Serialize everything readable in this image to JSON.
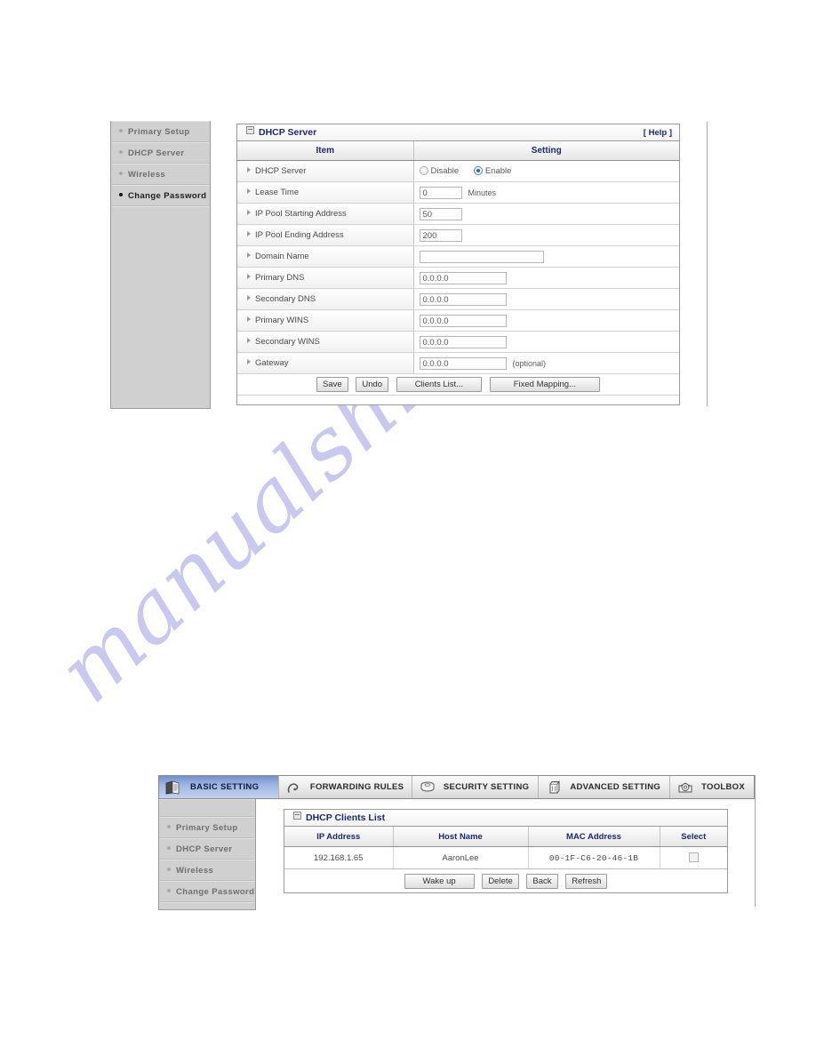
{
  "watermark": {
    "text": "manualshive.com"
  },
  "figure_top": {
    "sidebar": {
      "items": [
        {
          "label": "Primary Setup",
          "active": false
        },
        {
          "label": "DHCP Server",
          "active": false
        },
        {
          "label": "Wireless",
          "active": false
        },
        {
          "label": "Change Password",
          "active": true
        }
      ]
    },
    "panel": {
      "title": "DHCP Server",
      "help_label": "[ Help ]",
      "columns": {
        "item": "Item",
        "setting": "Setting"
      },
      "rows": [
        {
          "label": "DHCP Server",
          "type": "radio",
          "options": [
            {
              "label": "Disable",
              "selected": false
            },
            {
              "label": "Enable",
              "selected": true
            }
          ]
        },
        {
          "label": "Lease Time",
          "type": "text",
          "value": "0",
          "width": "small",
          "suffix": "Minutes"
        },
        {
          "label": "IP Pool Starting Address",
          "type": "text",
          "value": "50",
          "width": "small",
          "suffix": ""
        },
        {
          "label": "IP Pool Ending Address",
          "type": "text",
          "value": "200",
          "width": "small",
          "suffix": ""
        },
        {
          "label": "Domain Name",
          "type": "text",
          "value": "",
          "width": "wide",
          "suffix": ""
        },
        {
          "label": "Primary DNS",
          "type": "text",
          "value": "0.0.0.0",
          "width": "mid",
          "suffix": ""
        },
        {
          "label": "Secondary DNS",
          "type": "text",
          "value": "0.0.0.0",
          "width": "mid",
          "suffix": ""
        },
        {
          "label": "Primary WINS",
          "type": "text",
          "value": "0.0.0.0",
          "width": "mid",
          "suffix": ""
        },
        {
          "label": "Secondary WINS",
          "type": "text",
          "value": "0.0.0.0",
          "width": "mid",
          "suffix": ""
        },
        {
          "label": "Gateway",
          "type": "text",
          "value": "0.0.0.0",
          "width": "mid",
          "suffix": "(optional)"
        }
      ],
      "buttons": [
        {
          "label": "Save",
          "size": "normal"
        },
        {
          "label": "Undo",
          "size": "normal"
        },
        {
          "label": "Clients List...",
          "size": "wide"
        },
        {
          "label": "Fixed Mapping...",
          "size": "wide"
        }
      ]
    }
  },
  "figure_bottom": {
    "tabs": [
      {
        "label": "BASIC SETTING",
        "icon": "book-pages-icon",
        "active": true
      },
      {
        "label": "FORWARDING RULES",
        "icon": "arrow-loop-icon",
        "active": false
      },
      {
        "label": "SECURITY SETTING",
        "icon": "shield-stack-icon",
        "active": false
      },
      {
        "label": "ADVANCED SETTING",
        "icon": "tower-box-icon",
        "active": false
      },
      {
        "label": "TOOLBOX",
        "icon": "gear-toolbox-icon",
        "active": false
      }
    ],
    "sidebar": {
      "items": [
        {
          "label": "Primary Setup",
          "active": false
        },
        {
          "label": "DHCP Server",
          "active": false
        },
        {
          "label": "Wireless",
          "active": false
        },
        {
          "label": "Change Password",
          "active": false
        }
      ]
    },
    "panel": {
      "title": "DHCP Clients List",
      "columns": [
        "IP Address",
        "Host Name",
        "MAC Address",
        "Select"
      ],
      "rows": [
        {
          "ip": "192.168.1.65",
          "host": "AaronLee",
          "mac": "00-1F-C6-20-46-1B",
          "selected": false
        }
      ],
      "buttons": [
        {
          "label": "Wake up"
        },
        {
          "label": "Delete"
        },
        {
          "label": "Back"
        },
        {
          "label": "Refresh"
        }
      ]
    }
  }
}
